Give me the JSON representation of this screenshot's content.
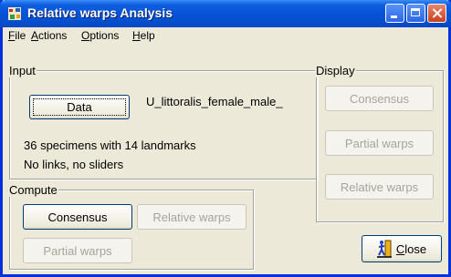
{
  "window": {
    "title": "Relative warps Analysis",
    "icon": "app-icon"
  },
  "menu": [
    {
      "label": "File",
      "key": "F",
      "rest": "ile"
    },
    {
      "label": "Actions",
      "key": "A",
      "rest": "ctions"
    },
    {
      "label": "Options",
      "key": "O",
      "rest": "ptions"
    },
    {
      "label": "Help",
      "key": "H",
      "rest": "elp"
    }
  ],
  "input": {
    "legend": "Input",
    "data_button": "Data",
    "file_name": "U_littoralis_female_male_",
    "specimens": "36 specimens with 14 landmarks",
    "links": "No links, no sliders"
  },
  "compute": {
    "legend": "Compute",
    "consensus": "Consensus",
    "relative_warps": "Relative warps",
    "partial_warps": "Partial warps"
  },
  "display": {
    "legend": "Display",
    "consensus": "Consensus",
    "partial_warps": "Partial warps",
    "relative_warps": "Relative warps"
  },
  "close": {
    "key": "C",
    "rest": "lose",
    "icon": "exit-door-icon"
  },
  "colors": {
    "titlebar": "#0754d8",
    "window_bg": "#ece9d8",
    "disabled_text": "#a6a49a"
  }
}
